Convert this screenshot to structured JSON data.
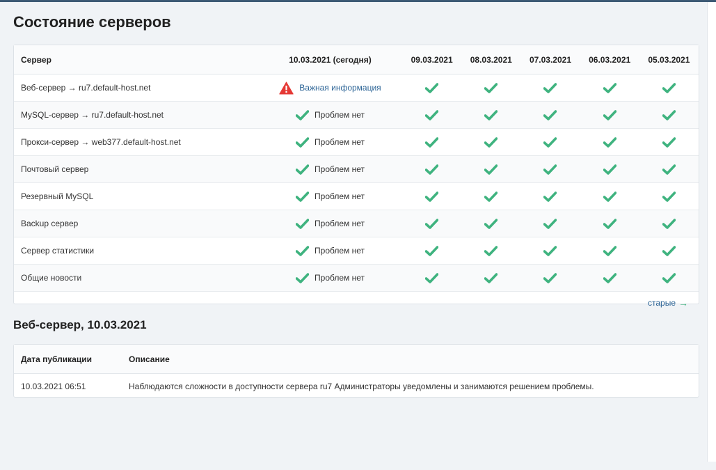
{
  "page": {
    "title": "Состояние серверов",
    "colors": {
      "accent": "#3fb37f",
      "link": "#2c6496",
      "warning": "#e53935"
    }
  },
  "status_table": {
    "headers": {
      "server": "Сервер",
      "today": "10.03.2021 (сегодня)",
      "dates": [
        "09.03.2021",
        "08.03.2021",
        "07.03.2021",
        "06.03.2021",
        "05.03.2021"
      ]
    },
    "rows": [
      {
        "name": "Веб-сервер → ru7.default-host.net",
        "today_text": "Важная информация",
        "today_status": "warning"
      },
      {
        "name": "MySQL-сервер → ru7.default-host.net",
        "today_text": "Проблем нет",
        "today_status": "ok"
      },
      {
        "name": "Прокси-сервер → web377.default-host.net",
        "today_text": "Проблем нет",
        "today_status": "ok"
      },
      {
        "name": "Почтовый сервер",
        "today_text": "Проблем нет",
        "today_status": "ok"
      },
      {
        "name": "Резервный MySQL",
        "today_text": "Проблем нет",
        "today_status": "ok"
      },
      {
        "name": "Backup сервер",
        "today_text": "Проблем нет",
        "today_status": "ok"
      },
      {
        "name": "Сервер статистики",
        "today_text": "Проблем нет",
        "today_status": "ok"
      },
      {
        "name": "Общие новости",
        "today_text": "Проблем нет",
        "today_status": "ok"
      }
    ],
    "history_icon": "check-icon",
    "older_link": "старые"
  },
  "news": {
    "title": "Веб-сервер, 10.03.2021",
    "headers": {
      "date": "Дата публикации",
      "description": "Описание"
    },
    "rows": [
      {
        "date": "10.03.2021 06:51",
        "description": "Наблюдаются сложности в доступности сервера ru7 Администраторы уведомлены и занимаются решением проблемы."
      }
    ]
  }
}
